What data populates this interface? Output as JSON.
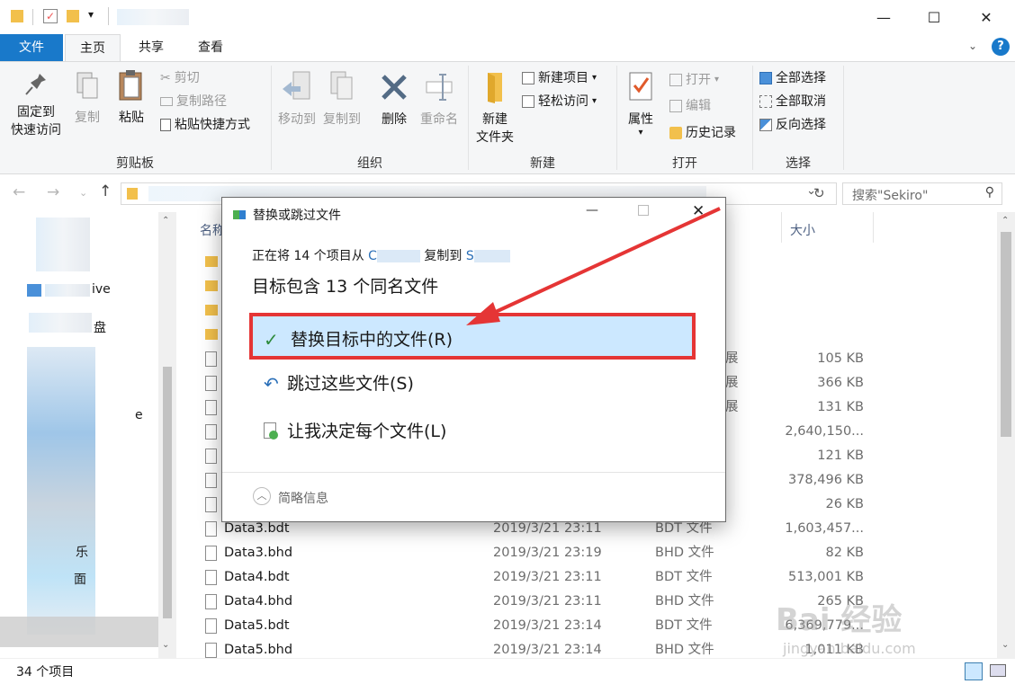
{
  "window": {
    "minimize_glyph": "—",
    "maximize_glyph": "☐",
    "close_glyph": "✕"
  },
  "ribbon_tabs": {
    "file": "文件",
    "home": "主页",
    "share": "共享",
    "view": "查看"
  },
  "clipboard": {
    "pin": "固定到\n快速访问",
    "pin_l1": "固定到",
    "pin_l2": "快速访问",
    "copy": "复制",
    "paste": "粘贴",
    "cut": "剪切",
    "copy_path": "复制路径",
    "paste_shortcut": "粘贴快捷方式",
    "group": "剪贴板"
  },
  "organize": {
    "move_to": "移动到",
    "copy_to": "复制到",
    "delete": "删除",
    "rename": "重命名",
    "group": "组织"
  },
  "new": {
    "new_folder_l1": "新建",
    "new_folder_l2": "文件夹",
    "new_item": "新建项目",
    "easy_access": "轻松访问",
    "group": "新建"
  },
  "open": {
    "properties": "属性",
    "open": "打开",
    "edit": "编辑",
    "history": "历史记录",
    "group": "打开"
  },
  "select": {
    "select_all": "全部选择",
    "select_none": "全部取消",
    "invert": "反向选择",
    "group": "选择"
  },
  "search": {
    "placeholder": "搜索\"Sekiro\""
  },
  "columns": {
    "name": "名称",
    "size": "大小"
  },
  "nav_fragments": {
    "onedrive": "ive",
    "disk": "盘",
    "e": "e",
    "music": "乐",
    "desktop": "面"
  },
  "files_partial": [
    {
      "type_frag": "展",
      "size": "105 KB"
    },
    {
      "type_frag": "展",
      "size": "366 KB"
    },
    {
      "type_frag": "展",
      "size": "131 KB"
    },
    {
      "size": "2,640,150..."
    },
    {
      "size": "121 KB"
    },
    {
      "size": "378,496 KB"
    },
    {
      "size": "26 KB"
    }
  ],
  "files": [
    {
      "name": "Data3.bdt",
      "date": "2019/3/21 23:11",
      "type": "BDT 文件",
      "size": "1,603,457..."
    },
    {
      "name": "Data3.bhd",
      "date": "2019/3/21 23:19",
      "type": "BHD 文件",
      "size": "82 KB"
    },
    {
      "name": "Data4.bdt",
      "date": "2019/3/21 23:11",
      "type": "BDT 文件",
      "size": "513,001 KB"
    },
    {
      "name": "Data4.bhd",
      "date": "2019/3/21 23:11",
      "type": "BHD 文件",
      "size": "265 KB"
    },
    {
      "name": "Data5.bdt",
      "date": "2019/3/21 23:14",
      "type": "BDT 文件",
      "size": "6,369,779..."
    },
    {
      "name": "Data5.bhd",
      "date": "2019/3/21 23:14",
      "type": "BHD 文件",
      "size": "1,011 KB"
    }
  ],
  "status": {
    "count": "34 个项目"
  },
  "dialog": {
    "title": "替换或跳过文件",
    "copying_prefix": "正在将 14 个项目从",
    "from_frag": "C",
    "copy_to": "复制到",
    "to_frag": "S",
    "heading": "目标包含 13 个同名文件",
    "replace": "替换目标中的文件(R)",
    "skip": "跳过这些文件(S)",
    "decide": "让我决定每个文件(L)",
    "details": "简略信息"
  },
  "watermark": {
    "brand": "Bai 经验",
    "url": "jingyan.baidu.com"
  },
  "colors": {
    "accent": "#1979ca",
    "highlight": "#cce8ff",
    "annotation": "#e53535"
  }
}
